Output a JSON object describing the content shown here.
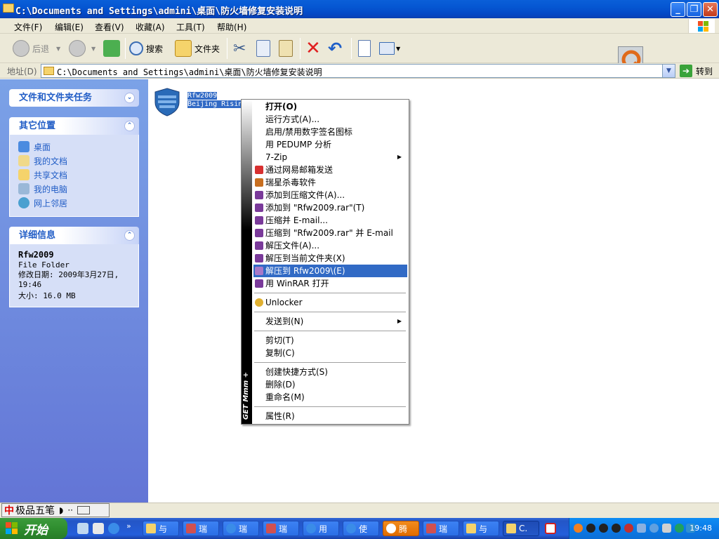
{
  "window": {
    "title": "C:\\Documents and Settings\\admini\\桌面\\防火墙修复安装说明",
    "controls": [
      "minimize",
      "maximize",
      "close"
    ]
  },
  "menubar": {
    "items": [
      "文件(F)",
      "编辑(E)",
      "查看(V)",
      "收藏(A)",
      "工具(T)",
      "帮助(H)"
    ]
  },
  "toolbar": {
    "back": "后退",
    "search": "搜索",
    "folders": "文件夹"
  },
  "address": {
    "label": "地址(D)",
    "value": "C:\\Documents and Settings\\admini\\桌面\\防火墙修复安装说明",
    "go": "转到"
  },
  "taskpane": {
    "tasks_header": "文件和文件夹任务",
    "places_header": "其它位置",
    "places": [
      "桌面",
      "我的文档",
      "共享文档",
      "我的电脑",
      "网上邻居"
    ],
    "details_header": "详细信息",
    "details": {
      "name": "Rfw2009",
      "type": "File Folder",
      "modified": "修改日期: 2009年3月27日, 19:46",
      "size": "大小: 16.0 MB"
    }
  },
  "file": {
    "name": "Rfw2009",
    "subtitle": "Beijing Risin"
  },
  "context_menu": {
    "strip_text": "GET Mmm +",
    "group1": [
      "打开(O)",
      "运行方式(A)...",
      "启用/禁用数字签名图标",
      "用 PEDUMP 分析",
      "7-Zip",
      "通过网易邮箱发送",
      "瑞星杀毒软件",
      "添加到压缩文件(A)...",
      "添加到 \"Rfw2009.rar\"(T)",
      "压缩并 E-mail...",
      "压缩到 \"Rfw2009.rar\" 并 E-mail",
      "解压文件(A)...",
      "解压到当前文件夹(X)",
      "解压到 Rfw2009\\(E)",
      "用 WinRAR 打开"
    ],
    "unlocker": "Unlocker",
    "sendto": "发送到(N)",
    "cut": "剪切(T)",
    "copy": "复制(C)",
    "create_shortcut": "创建快捷方式(S)",
    "delete": "删除(D)",
    "rename": "重命名(M)",
    "properties": "属性(R)",
    "selected": "解压到 Rfw2009\\(E)"
  },
  "ime": {
    "name": "极品五笔"
  },
  "taskbar": {
    "start": "开始",
    "tasks": [
      "与",
      "瑞",
      "瑞",
      "瑞",
      "用",
      "使",
      "腾",
      "瑞",
      "与",
      "C."
    ],
    "clock": "19:48"
  },
  "colors": {
    "titlebar": "#0556d2",
    "selection": "#316ac5",
    "taskpane": "#6f8ee0",
    "start": "#2f8e2f"
  }
}
